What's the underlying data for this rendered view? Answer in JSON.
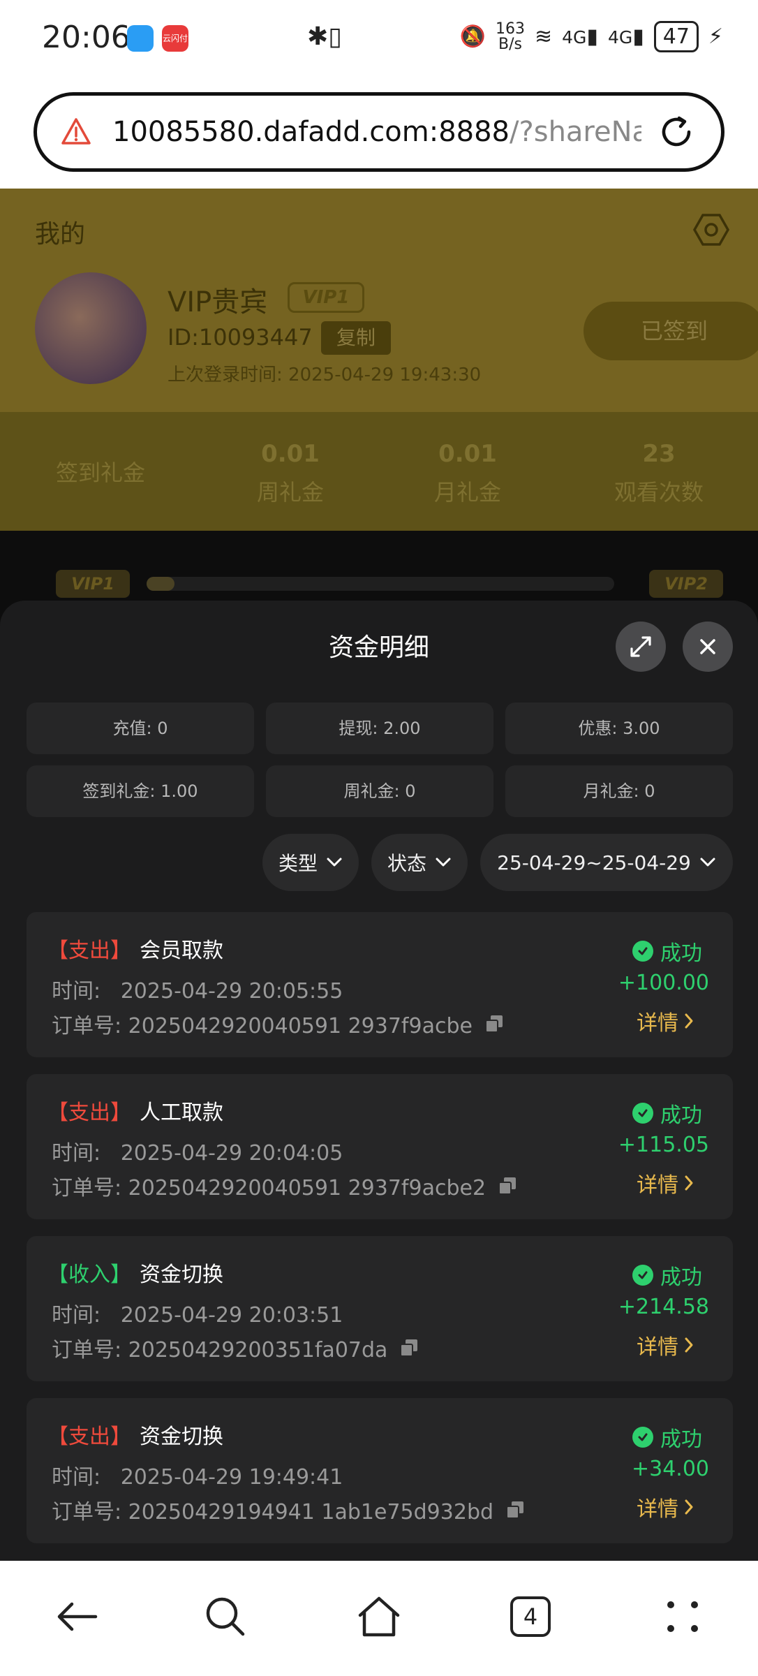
{
  "status_bar": {
    "time": "20:06",
    "net_speed_top": "163",
    "net_speed_bottom": "B/s",
    "network_left": "4G",
    "network_right": "4G",
    "battery": "47",
    "app_icon_2": "云闪付"
  },
  "browser": {
    "url_main": "10085580.dafadd.com:8888",
    "url_rest": "/?shareName="
  },
  "background_page": {
    "title": "我的",
    "vip_name": "VIP贵宾",
    "vip_badge": "VIP1",
    "user_id": "ID:10093447",
    "copy_label": "复制",
    "last_login": "上次登录时间:   2025-04-29 19:43:30",
    "signed_label": "已签到",
    "stats": [
      {
        "value": "",
        "label": "签到礼金"
      },
      {
        "value": "0.01",
        "label": "周礼金"
      },
      {
        "value": "0.01",
        "label": "月礼金"
      },
      {
        "value": "23",
        "label": "观看次数"
      }
    ],
    "level_start": "VIP1",
    "level_end": "VIP2"
  },
  "sheet": {
    "title": "资金明细",
    "summary": [
      "充值: 0",
      "提现: 2.00",
      "优惠: 3.00",
      "签到礼金: 1.00",
      "周礼金: 0",
      "月礼金: 0"
    ],
    "filters": {
      "type": "类型",
      "status": "状态",
      "date_range": "25-04-29~25-04-29"
    },
    "time_label": "时间:",
    "order_label": "订单号:",
    "detail_label": "详情",
    "records": [
      {
        "kind": "【支出】",
        "kind_class": "out",
        "name": "会员取款",
        "time": "2025-04-29 20:05:55",
        "order": "2025042920040591 2937f9acbe",
        "status": "成功",
        "amount": "+100.00"
      },
      {
        "kind": "【支出】",
        "kind_class": "out",
        "name": "人工取款",
        "time": "2025-04-29 20:04:05",
        "order": "2025042920040591 2937f9acbe2",
        "status": "成功",
        "amount": "+115.05"
      },
      {
        "kind": "【收入】",
        "kind_class": "in",
        "name": "资金切换",
        "time": "2025-04-29 20:03:51",
        "order": "20250429200351fa07da",
        "status": "成功",
        "amount": "+214.58"
      },
      {
        "kind": "【支出】",
        "kind_class": "out",
        "name": "资金切换",
        "time": "2025-04-29 19:49:41",
        "order": "20250429194941 1ab1e75d932bd",
        "status": "成功",
        "amount": "+34.00"
      }
    ]
  },
  "bottom_nav": {
    "tabs_count": "4"
  },
  "colors": {
    "expense": "#ef4a3c",
    "income": "#2ed06e",
    "detail": "#e8b94d",
    "sheet_bg": "#1c1c1d"
  }
}
